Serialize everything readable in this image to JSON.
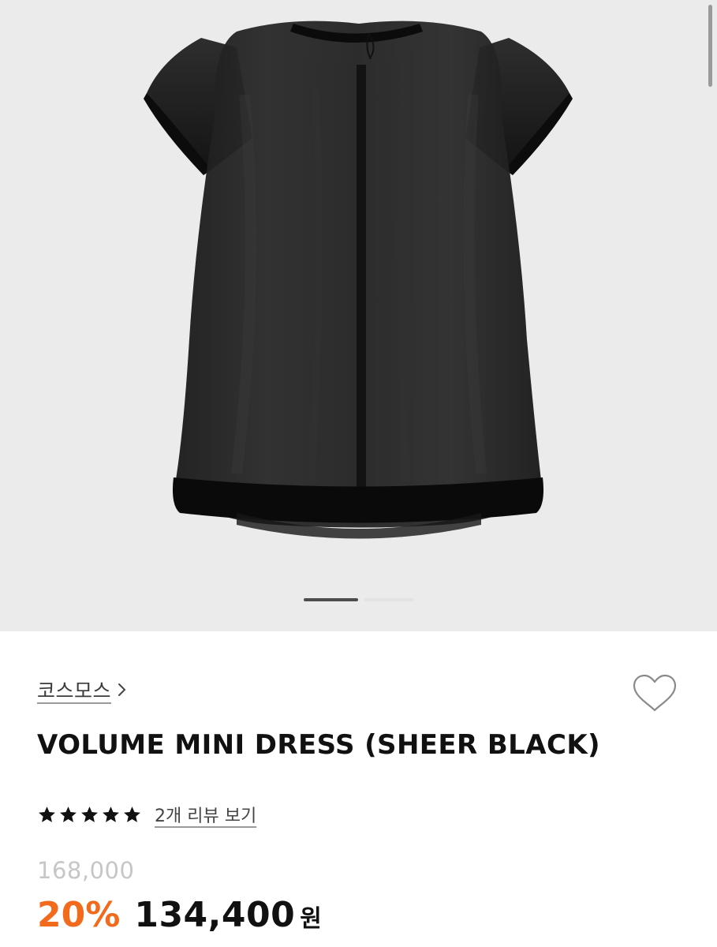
{
  "gallery": {
    "image_alt": "black sheer volume mini dress",
    "pager": {
      "current": 1,
      "total": 2
    }
  },
  "product": {
    "brand": "코스모스",
    "title": "VOLUME MINI DRESS (SHEER BLACK)",
    "rating": {
      "stars": 5,
      "reviews_label": "2개 리뷰 보기"
    },
    "price": {
      "original": "168,000",
      "discount": "20%",
      "sale": "134,400",
      "currency": "원"
    }
  },
  "icons": {
    "brand_chevron": "chevron-right-icon",
    "wishlist": "heart-outline-icon",
    "star": "star-filled-icon"
  },
  "colors": {
    "gallery_background": "#ebebeb",
    "discount": "#f26a1b",
    "text": "#111111",
    "muted": "#c6c6c6"
  }
}
